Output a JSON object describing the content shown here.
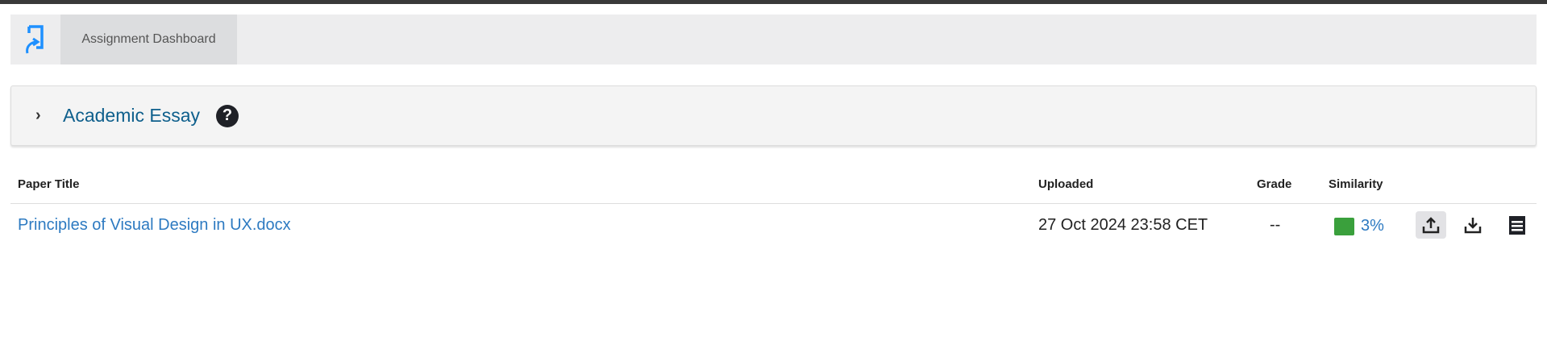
{
  "nav": {
    "tab_label": "Assignment Dashboard"
  },
  "assignment": {
    "title": "Academic Essay",
    "help": "?"
  },
  "table": {
    "headers": {
      "title": "Paper Title",
      "uploaded": "Uploaded",
      "grade": "Grade",
      "similarity": "Similarity"
    },
    "rows": [
      {
        "title": "Principles of Visual Design in UX.docx",
        "uploaded": "27 Oct 2024 23:58 CET",
        "grade": "--",
        "similarity": "3%",
        "similarity_color": "#3aa03c"
      }
    ]
  },
  "colors": {
    "accent": "#2d7ac1",
    "logo": "#1e90ff"
  }
}
